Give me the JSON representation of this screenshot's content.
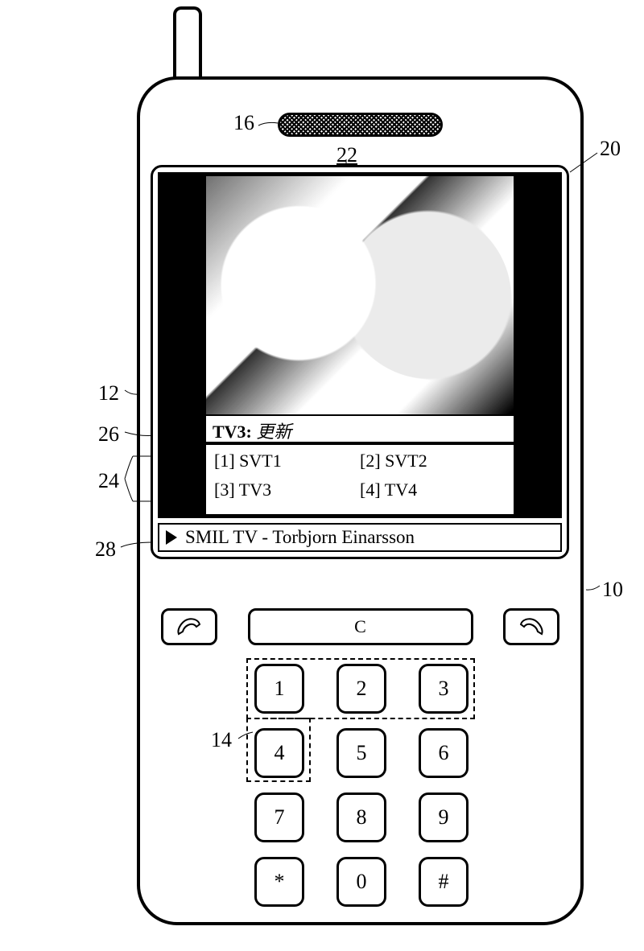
{
  "callouts": {
    "l16": "16",
    "l22": "22",
    "l20": "20",
    "l12": "12",
    "l26": "26",
    "l24": "24",
    "l28": "28",
    "l10": "10",
    "l14": "14"
  },
  "screen": {
    "ticker_channel": "TV3:",
    "ticker_text": "更新",
    "channels": [
      {
        "idx": "[1]",
        "name": "SVT1"
      },
      {
        "idx": "[2]",
        "name": "SVT2"
      },
      {
        "idx": "[3]",
        "name": "TV3"
      },
      {
        "idx": "[4]",
        "name": "TV4"
      }
    ],
    "status": "SMIL TV - Torbjorn Einarsson"
  },
  "fn_row": {
    "middle_label": "C"
  },
  "keypad": [
    "1",
    "2",
    "3",
    "4",
    "5",
    "6",
    "7",
    "8",
    "9",
    "*",
    "0",
    "#"
  ]
}
